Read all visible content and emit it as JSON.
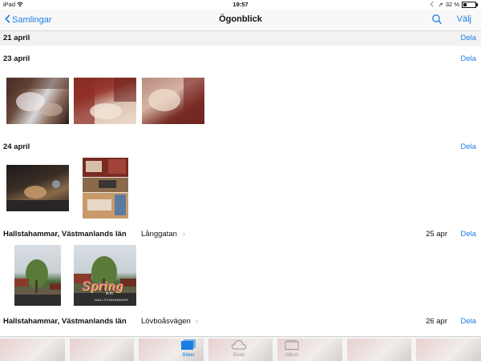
{
  "status_bar": {
    "device": "iPad",
    "time": "19:57",
    "battery": "32 %",
    "battery_level": 0.32
  },
  "nav": {
    "back_label": "Samlingar",
    "title": "Ögonblick",
    "select_label": "Välj"
  },
  "sections": [
    {
      "date": "21 april",
      "share_label": "Dela"
    },
    {
      "date": "23 april",
      "share_label": "Dela"
    },
    {
      "date": "24 april",
      "share_label": "Dela"
    },
    {
      "date": "Hallstahammar, Västmanlands län",
      "place": "Långgatan",
      "right_date": "25 apr",
      "share_label": "Dela"
    },
    {
      "date": "Hallstahammar, Västmanlands län",
      "place": "Lövboåsvägen",
      "right_date": "26 apr",
      "share_label": "Dela"
    }
  ],
  "collage_text": {
    "title": "Spring",
    "line1": "is in",
    "line2": "HALLSTAHAMMAR"
  },
  "tabs": [
    {
      "label": "Bilder",
      "icon": "photos-icon",
      "active": true
    },
    {
      "label": "Delat",
      "icon": "cloud-icon",
      "active": false
    },
    {
      "label": "Album",
      "icon": "album-icon",
      "active": false
    }
  ],
  "colors": {
    "accent": "#1a7ee0"
  }
}
